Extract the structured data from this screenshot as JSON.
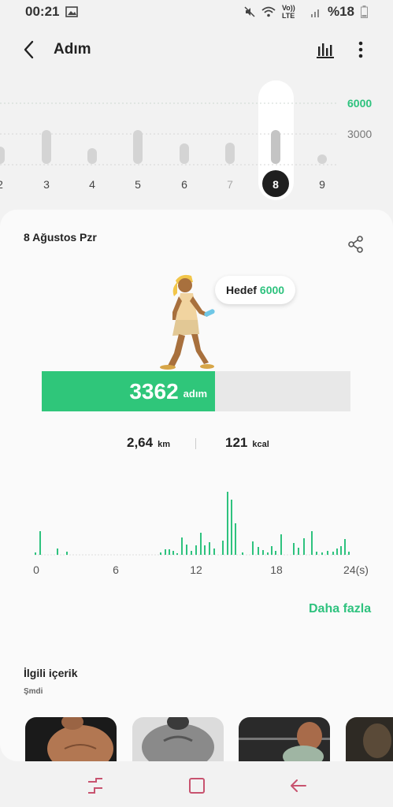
{
  "status": {
    "time": "00:21",
    "network": "Vo)) LTE",
    "battery": "%18"
  },
  "header": {
    "title": "Adım"
  },
  "week": {
    "days": [
      "2",
      "3",
      "4",
      "5",
      "6",
      "7",
      "8",
      "9"
    ],
    "selected": "8",
    "goal_line_label": "6000",
    "mid_line_label": "3000"
  },
  "day": {
    "date": "8 Ağustos Pzr",
    "goal_label": "Hedef",
    "goal_value": "6000",
    "steps": "3362",
    "steps_unit": "adım",
    "progress_fraction": 0.56,
    "distance": "2,64",
    "distance_unit": "km",
    "calories": "121",
    "calories_unit": "kcal"
  },
  "hourly_chart": {
    "x_ticks": [
      "0",
      "6",
      "12",
      "18",
      "24(s)"
    ],
    "more_link": "Daha fazla"
  },
  "related": {
    "title": "İlgili içerik",
    "subtitle": "Şmdi"
  },
  "colors": {
    "accent": "#2ec27e",
    "dark": "#1f1f1f"
  },
  "icons": {
    "back": "back-arrow-icon",
    "chart": "bar-chart-icon",
    "more": "more-vertical-icon",
    "share": "share-icon"
  }
}
